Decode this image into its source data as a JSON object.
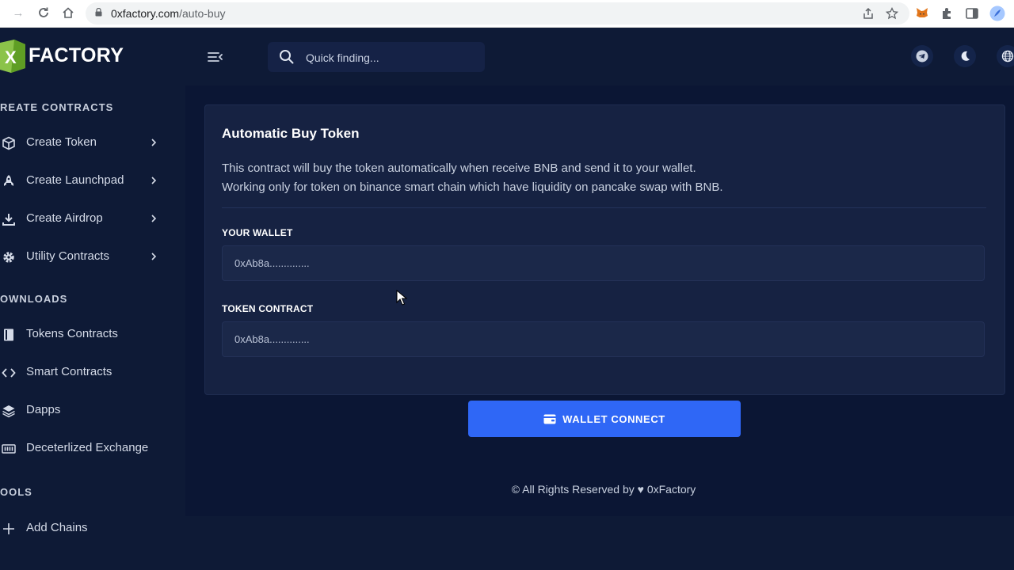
{
  "browser": {
    "url_domain": "0xfactory.com",
    "url_path": "/auto-buy"
  },
  "brand": {
    "name": "FACTORY",
    "logo_letter": "X"
  },
  "header": {
    "search_placeholder": "Quick finding...",
    "icons": [
      "menu-collapse-icon",
      "search-icon",
      "telegram-icon",
      "moon-icon",
      "globe-icon"
    ]
  },
  "sidebar": {
    "sections": [
      {
        "title": "REATE CONTRACTS"
      },
      {
        "title": "OWNLOADS"
      },
      {
        "title": "OOLS"
      }
    ],
    "items": [
      {
        "label": "Create Token",
        "icon": "cube-icon",
        "has_submenu": true
      },
      {
        "label": "Create Launchpad",
        "icon": "rocket-icon",
        "has_submenu": true
      },
      {
        "label": "Create Airdrop",
        "icon": "download-icon",
        "has_submenu": true
      },
      {
        "label": "Utility Contracts",
        "icon": "gear-icon",
        "has_submenu": true
      },
      {
        "label": "Tokens Contracts",
        "icon": "book-icon",
        "has_submenu": false
      },
      {
        "label": "Smart Contracts",
        "icon": "code-icon",
        "has_submenu": false
      },
      {
        "label": "Dapps",
        "icon": "layers-icon",
        "has_submenu": false
      },
      {
        "label": "Deceterlized Exchange",
        "icon": "exchange-icon",
        "has_submenu": false
      },
      {
        "label": "Add Chains",
        "icon": "plus-icon",
        "has_submenu": false
      }
    ]
  },
  "main": {
    "card_title": "Automatic Buy Token",
    "desc_line1": "This contract will buy the token automatically when receive BNB and send it to your wallet.",
    "desc_line2": "Working only for token on binance smart chain which have liquidity on pancake swap with BNB.",
    "wallet_label": "YOUR WALLET",
    "wallet_placeholder": "0xAb8a..............",
    "token_label": "TOKEN CONTRACT",
    "token_placeholder": "0xAb8a..............",
    "connect_label": "WALLET CONNECT",
    "footer": "© All Rights Reserved by ♥ 0xFactory"
  },
  "colors": {
    "background": "#0e1a36",
    "card": "#162242",
    "accent": "#2f67f6",
    "logo_green": "#8bc34a"
  }
}
